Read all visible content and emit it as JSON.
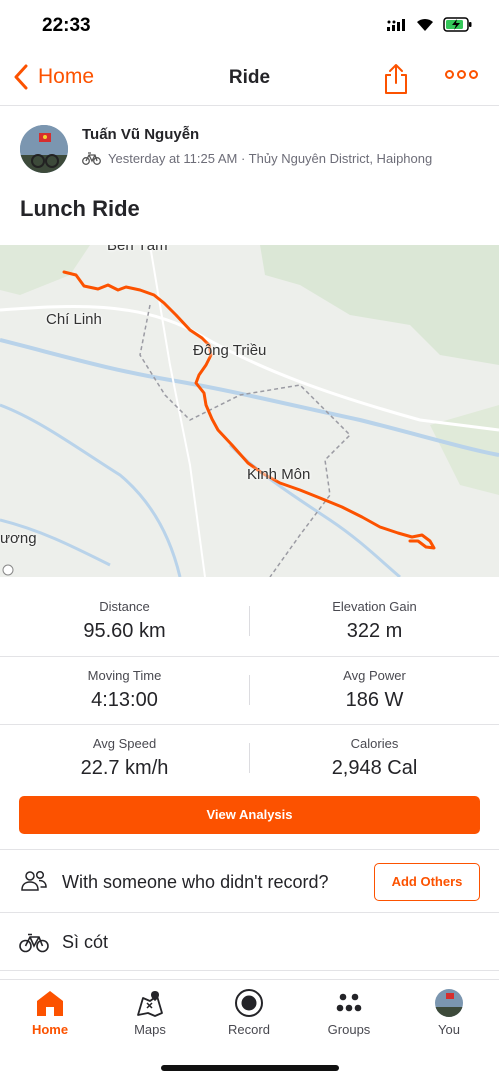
{
  "status": {
    "time": "22:33",
    "icons": [
      "signal-icon",
      "wifi-icon",
      "battery-charging-icon"
    ]
  },
  "nav": {
    "back_label": "Home",
    "title": "Ride",
    "share_icon": "share-icon",
    "more_icon": "more-icon"
  },
  "athlete": {
    "name": "Tuấn Vũ Nguyễn",
    "meta": "Yesterday at 11:25 AM · Thủy Nguyên District, Haiphong",
    "activity_type_icon": "bike-icon"
  },
  "activity": {
    "title": "Lunch Ride"
  },
  "map": {
    "labels": [
      "Bến Tắm",
      "Chí Linh",
      "Đông Triều",
      "Kinh Môn",
      "ương"
    ],
    "route_color": "#fc5200"
  },
  "stats": [
    {
      "label": "Distance",
      "value": "95.60 km"
    },
    {
      "label": "Elevation Gain",
      "value": "322 m"
    },
    {
      "label": "Moving Time",
      "value": "4:13:00"
    },
    {
      "label": "Avg Power",
      "value": "186 W"
    },
    {
      "label": "Avg Speed",
      "value": "22.7 km/h"
    },
    {
      "label": "Calories",
      "value": "2,948 Cal"
    }
  ],
  "actions": {
    "view_analysis": "View Analysis",
    "with_someone": "With someone who didn't record?",
    "add_others": "Add Others",
    "gear": "Sì cót"
  },
  "tabs": [
    {
      "label": "Home",
      "icon": "home-icon",
      "active": true
    },
    {
      "label": "Maps",
      "icon": "maps-icon",
      "active": false
    },
    {
      "label": "Record",
      "icon": "record-icon",
      "active": false
    },
    {
      "label": "Groups",
      "icon": "groups-icon",
      "active": false
    },
    {
      "label": "You",
      "icon": "avatar",
      "active": false
    }
  ],
  "colors": {
    "brand": "#fc5200",
    "text": "#242428",
    "muted": "#6d6d78"
  }
}
